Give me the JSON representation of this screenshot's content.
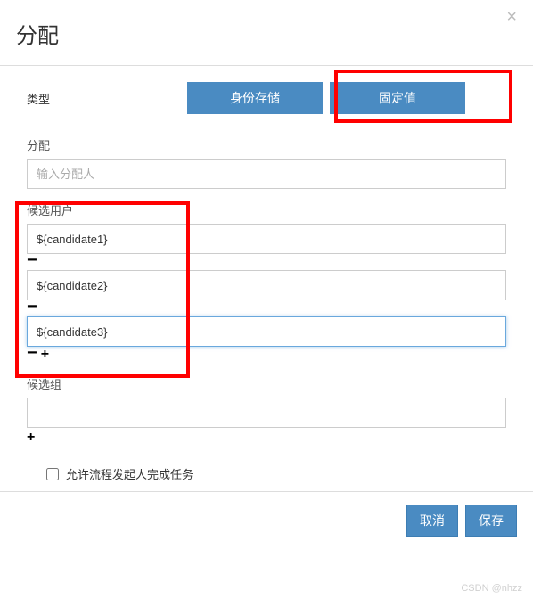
{
  "header": {
    "title": "分配",
    "close": "×"
  },
  "type": {
    "label": "类型",
    "tab_identity": "身份存储",
    "tab_fixed": "固定值"
  },
  "assign": {
    "label": "分配",
    "placeholder": "输入分配人",
    "value": ""
  },
  "candidateUsers": {
    "label": "候选用户",
    "items": [
      "${candidate1}",
      "${candidate2}",
      "${candidate3}"
    ]
  },
  "candidateGroups": {
    "label": "候选组",
    "value": ""
  },
  "checkbox": {
    "label": "允许流程发起人完成任务"
  },
  "footer": {
    "cancel": "取消",
    "save": "保存"
  },
  "watermark": "CSDN @nhzz"
}
